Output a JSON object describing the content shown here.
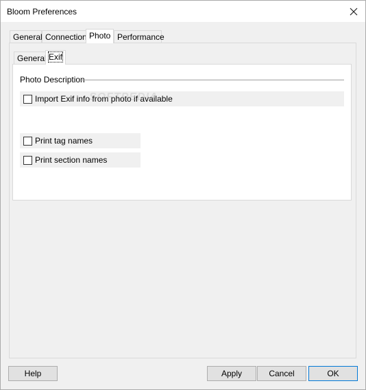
{
  "window": {
    "title": "Bloom Preferences"
  },
  "tabs_outer": [
    {
      "label": "General"
    },
    {
      "label": "Connection"
    },
    {
      "label": "Photo"
    },
    {
      "label": "Performance"
    }
  ],
  "tabs_inner": [
    {
      "label": "General"
    },
    {
      "label": "Exif"
    }
  ],
  "group": {
    "title": "Photo Description"
  },
  "watermark": "SOFTPEDIA",
  "checkboxes": {
    "import_exif": {
      "label": "Import Exif info from photo if available",
      "checked": false
    },
    "print_tag_names": {
      "label": "Print tag names",
      "checked": false
    },
    "print_section_names": {
      "label": "Print section names",
      "checked": false
    }
  },
  "buttons": {
    "help": "Help",
    "apply": "Apply",
    "cancel": "Cancel",
    "ok": "OK"
  },
  "colors": {
    "window_bg": "#f0f0f0",
    "panel_bg": "#ffffff",
    "button_bg": "#e1e1e1",
    "default_button_border": "#0078d7"
  }
}
